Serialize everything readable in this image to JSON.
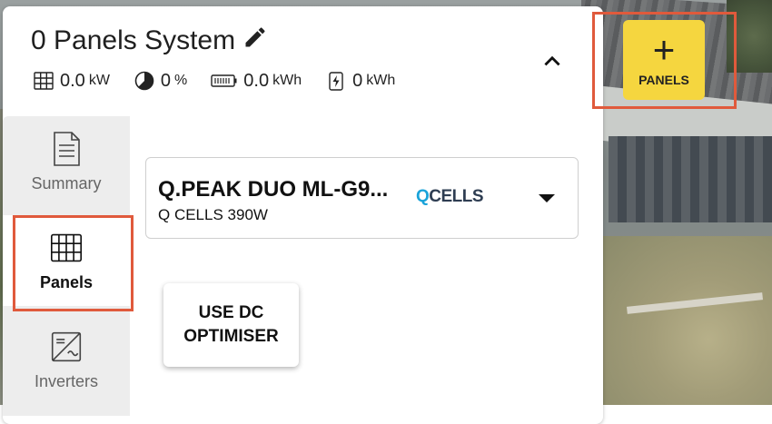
{
  "system": {
    "title": "0 Panels System",
    "stats": [
      {
        "icon": "panel-grid-icon",
        "value": "0.0",
        "unit": "kW"
      },
      {
        "icon": "pie-chart-icon",
        "value": "0",
        "unit": "%"
      },
      {
        "icon": "battery-icon",
        "value": "0.0",
        "unit": "kWh"
      },
      {
        "icon": "energy-bolt-icon",
        "value": "0",
        "unit": "kWh"
      }
    ]
  },
  "nav": {
    "summary": "Summary",
    "panels": "Panels",
    "inverters": "Inverters"
  },
  "panel_selector": {
    "model": "Q.PEAK DUO ML-G9...",
    "subtitle": "Q CELLS 390W",
    "brand_logo": "QCELLS"
  },
  "dc_button": {
    "label": "USE DC\nOPTIMISER"
  },
  "add_panels": {
    "label": "PANELS"
  },
  "colors": {
    "accent": "#f5d63f",
    "highlight": "#e05a3c"
  }
}
